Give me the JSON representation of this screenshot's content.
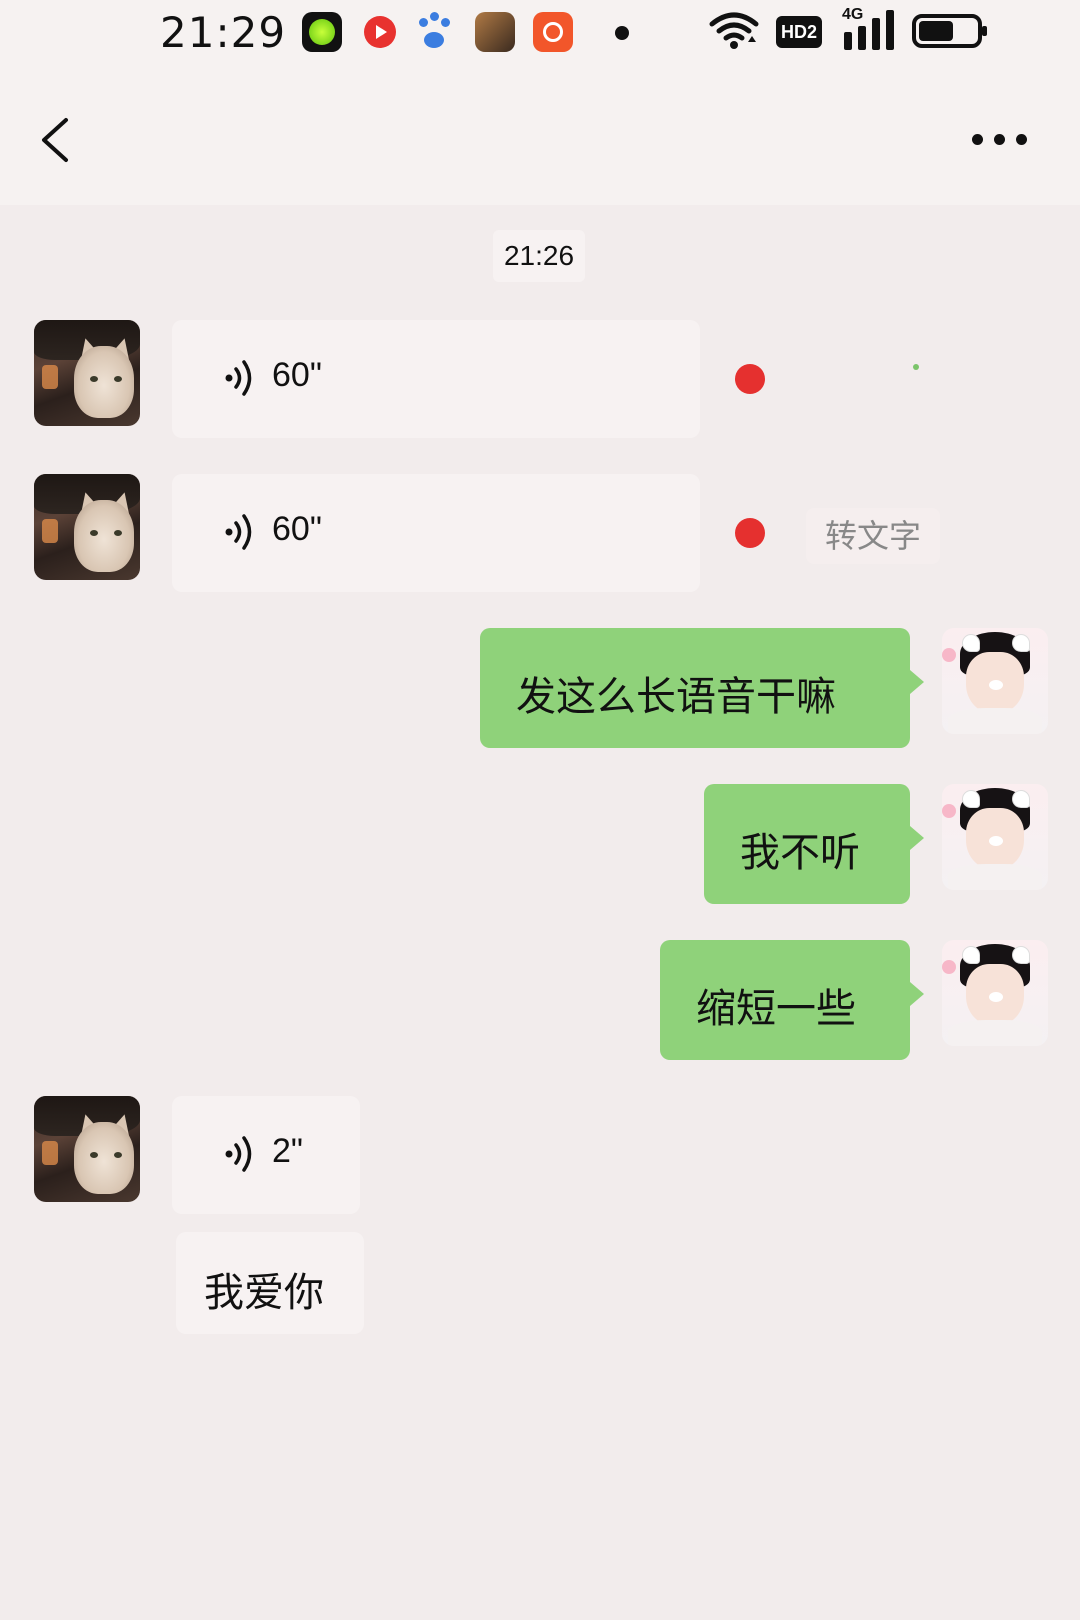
{
  "status_bar": {
    "time": "21:29",
    "app_icons": [
      "green-app-icon",
      "video-app-icon",
      "baidu-app-icon",
      "game-app-icon",
      "kuaishou-app-icon"
    ],
    "network_label": "4G",
    "hd_label": "HD2"
  },
  "nav": {
    "back_icon": "chevron-left-icon",
    "more_icon": "more-dots-icon"
  },
  "chat": {
    "timestamp": "21:26",
    "messages": [
      {
        "type": "voice",
        "direction": "incoming",
        "duration": "60\"",
        "unread": true
      },
      {
        "type": "voice",
        "direction": "incoming",
        "duration": "60\"",
        "unread": true,
        "action": "转文字"
      },
      {
        "type": "text",
        "direction": "outgoing",
        "text": "发这么长语音干嘛"
      },
      {
        "type": "text",
        "direction": "outgoing",
        "text": "我不听"
      },
      {
        "type": "text",
        "direction": "outgoing",
        "text": "缩短一些"
      },
      {
        "type": "voice",
        "direction": "incoming",
        "duration": "2\"",
        "unread": false
      },
      {
        "type": "text",
        "direction": "incoming",
        "text": "我爱你"
      }
    ]
  },
  "colors": {
    "background": "#f2ecec",
    "outgoing_bubble": "#8fd27a",
    "incoming_bubble": "#f7f2f2",
    "unread_dot": "#e5302f"
  }
}
